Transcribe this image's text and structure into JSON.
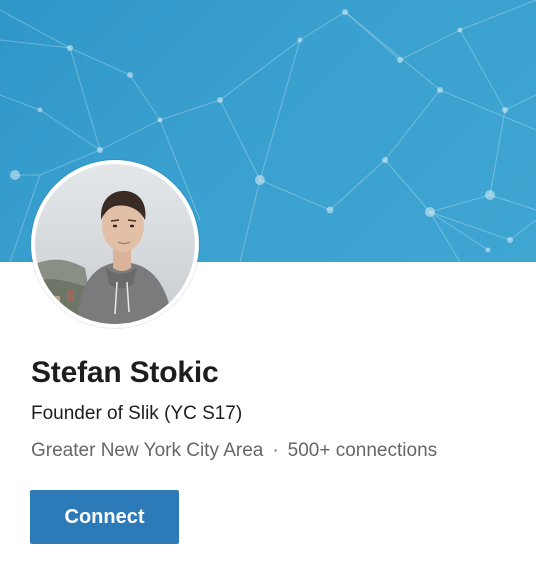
{
  "profile": {
    "name": "Stefan Stokic",
    "headline": "Founder of Slik (YC S17)",
    "location": "Greater New York City Area",
    "separator": "·",
    "connections": "500+ connections"
  },
  "actions": {
    "connect_label": "Connect"
  },
  "colors": {
    "banner": "#3aa0cf",
    "button": "#2d7ab8",
    "primary_text": "#1d1d1d",
    "secondary_text": "#666666"
  },
  "icons": {
    "banner": "network-pattern",
    "avatar": "profile-photo"
  }
}
